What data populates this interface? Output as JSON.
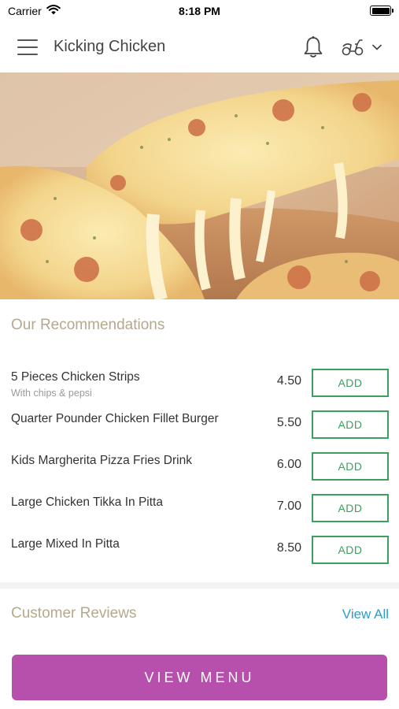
{
  "status_bar": {
    "carrier": "Carrier",
    "time": "8:18 PM"
  },
  "header": {
    "title": "Kicking Chicken",
    "icons": [
      "menu-icon",
      "bell-icon",
      "scooter-icon",
      "chevron-down-icon"
    ]
  },
  "hero": {
    "image": "cheese-pizza-slice"
  },
  "recommendations": {
    "title": "Our Recommendations",
    "items": [
      {
        "name": "5 Pieces Chicken Strips",
        "subtitle": "With chips & pepsi",
        "price": "4.50",
        "button": "ADD"
      },
      {
        "name": "Quarter Pounder Chicken Fillet Burger",
        "subtitle": "",
        "price": "5.50",
        "button": "ADD"
      },
      {
        "name": "Kids Margherita Pizza Fries Drink",
        "subtitle": "",
        "price": "6.00",
        "button": "ADD"
      },
      {
        "name": "Large Chicken Tikka In Pitta",
        "subtitle": "",
        "price": "7.00",
        "button": "ADD"
      },
      {
        "name": "Large Mixed In Pitta",
        "subtitle": "",
        "price": "8.50",
        "button": "ADD"
      }
    ]
  },
  "reviews": {
    "title": "Customer Reviews",
    "view_all": "View All"
  },
  "footer": {
    "view_menu": "VIEW MENU"
  },
  "colors": {
    "section_title": "#b6a88c",
    "add_green": "#3aa05e",
    "link_blue": "#2b9ec8",
    "primary_purple": "#b650ac"
  }
}
